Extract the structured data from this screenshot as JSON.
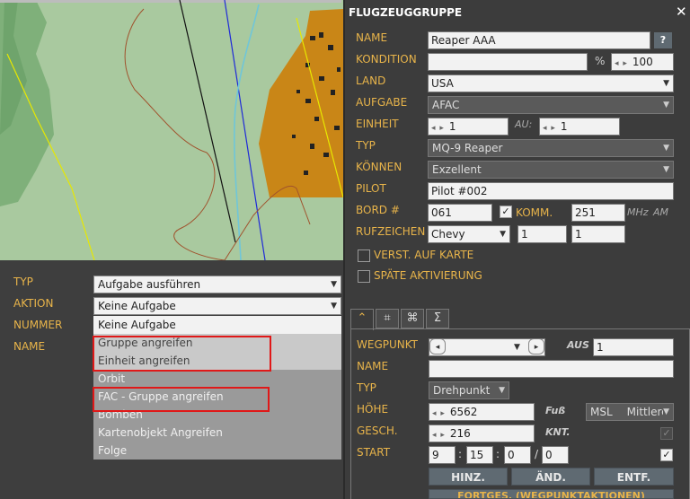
{
  "left": {
    "typ_label": "TYP",
    "aktion_label": "AKTION",
    "nummer_label": "NUMMER",
    "name_label": "NAME",
    "typ_value": "Aufgabe ausführen",
    "aktion_value": "Keine Aufgabe",
    "aktion_options": [
      "Keine Aufgabe",
      "Gruppe angreifen",
      "Einheit angreifen",
      "Orbit",
      "FAC - Gruppe angreifen",
      "Bomben",
      "Kartenobjekt Angreifen",
      "Folge"
    ]
  },
  "panel": {
    "title": "FLUGZEUGGRUPPE",
    "close": "✕",
    "name_label": "NAME",
    "name_value": "Reaper AAA",
    "help": "?",
    "kondition_label": "KONDITION",
    "kondition_value": "",
    "percent": "%",
    "kondition_pct": "100",
    "land_label": "LAND",
    "land_value": "USA",
    "aufgabe_label": "AUFGABE",
    "aufgabe_value": "AFAC",
    "einheit_label": "EINHEIT",
    "einheit_value": "1",
    "au_label": "AU:",
    "au_value": "1",
    "typ_label": "TYP",
    "typ_value": "MQ-9 Reaper",
    "koennen_label": "KÖNNEN",
    "koennen_value": "Exzellent",
    "pilot_label": "PILOT",
    "pilot_value": "Pilot #002",
    "bord_label": "BORD #",
    "bord_value": "061",
    "komm_label": "KOMM.",
    "komm_value": "251",
    "mhz": "MHz",
    "am": "AM",
    "ruf_label": "RUFZEICHEN",
    "ruf_value": "Chevy",
    "ruf_n1": "1",
    "ruf_n2": "1",
    "verst_label": "VERST. AUF KARTE",
    "spaet_label": "SPÄTE AKTIVIERUNG"
  },
  "tabs": [
    "⌃",
    "⌗",
    "⌘",
    "Σ"
  ],
  "wp": {
    "wegpunkt_label": "WEGPUNKT",
    "aus_label": "AUS",
    "aus_value": "1",
    "name_label": "NAME",
    "name_value": "",
    "typ_label": "TYP",
    "typ_value": "Drehpunkt",
    "hoehe_label": "HÖHE",
    "hoehe_value": "6562",
    "fuss": "Fuß",
    "msl": "MSL",
    "mittlere": "Mittlere",
    "gesch_label": "GESCH.",
    "gesch_value": "216",
    "knt": "KNT.",
    "start_label": "START",
    "start_h": "9",
    "start_m": "15",
    "start_s": "0",
    "slash": "/",
    "start_d": "0",
    "colon": ":",
    "hinz": "HINZ.",
    "aend": "ÄND.",
    "entf": "ENTF.",
    "fortges": "FORTGES. (WEGPUNKTAKTIONEN)"
  }
}
